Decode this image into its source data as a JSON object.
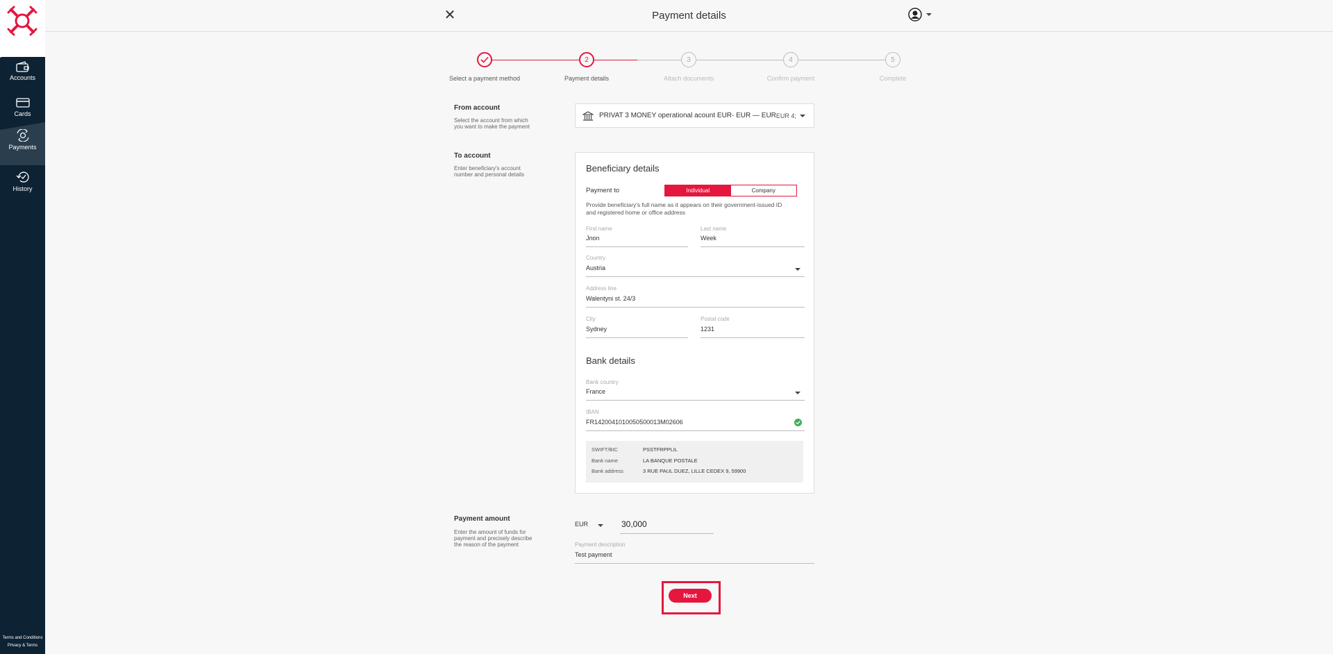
{
  "header": {
    "title": "Payment details"
  },
  "sidebar": {
    "items": [
      {
        "label": "Accounts",
        "icon": "wallet-icon"
      },
      {
        "label": "Cards",
        "icon": "card-icon"
      },
      {
        "label": "Payments",
        "icon": "payments-icon"
      },
      {
        "label": "History",
        "icon": "history-icon"
      }
    ],
    "footer_terms": "Terms and Conditions",
    "footer_privacy": "Privacy & Terms"
  },
  "stepper": {
    "steps": [
      {
        "number": "",
        "label": "Select a payment method",
        "state": "done"
      },
      {
        "number": "2",
        "label": "Payment details",
        "state": "current"
      },
      {
        "number": "3",
        "label": "Attach documents",
        "state": "todo"
      },
      {
        "number": "4",
        "label": "Confirm payment",
        "state": "todo"
      },
      {
        "number": "5",
        "label": "Complete",
        "state": "todo"
      }
    ]
  },
  "from_account": {
    "title": "From account",
    "subtitle": "Select the account from which you want to make the payment",
    "selected": "PRIVAT 3 MONEY operational acount EUR- EUR — EUR",
    "balance_truncated": "EUR 4;"
  },
  "to_account": {
    "title": "To account",
    "subtitle": "Enter beneficiary's account number and personal details"
  },
  "beneficiary": {
    "heading": "Beneficiary details",
    "payment_to_label": "Payment to",
    "option_individual": "Individual",
    "option_company": "Company",
    "hint": "Provide beneficiary's full name as it appears on their government-issued ID and registered home or office address",
    "first_name_label": "First name",
    "first_name": "Jnon",
    "last_name_label": "Last name",
    "last_name": "Week",
    "country_label": "Country",
    "country": "Austria",
    "address_label": "Address line",
    "address": "Walentyni st. 24/3",
    "city_label": "City",
    "city": "Sydney",
    "postal_label": "Postal code",
    "postal": "1231"
  },
  "bank": {
    "heading": "Bank details",
    "country_label": "Bank country",
    "country": "France",
    "iban_label": "IBAN",
    "iban": "FR1420041010050500013M02606",
    "swift_key": "SWIFT/BIC",
    "swift": "PSSTFRPPLIL",
    "name_key": "Bank name",
    "name": "LA BANQUE POSTALE",
    "address_key": "Bank address",
    "address": "3 RUE PAUL DUEZ, LILLE CEDEX 9, 59900"
  },
  "amount": {
    "title": "Payment amount",
    "subtitle": "Enter the amount of funds for payment and precisely describe the reason of the payment",
    "currency": "EUR",
    "value": "30,000",
    "description_label": "Payment description",
    "description": "Test payment"
  },
  "actions": {
    "next_label": "Next"
  },
  "colors": {
    "accent": "#e5173f",
    "sidebar": "#0d2233",
    "valid": "#3fae5a"
  }
}
